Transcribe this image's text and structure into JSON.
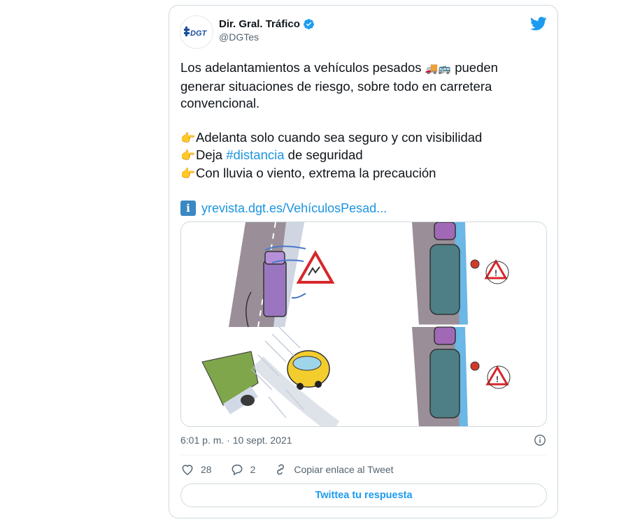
{
  "author": {
    "display_name": "Dir. Gral. Tráfico",
    "handle": "@DGTes",
    "avatar_text": "DGT",
    "verified": true
  },
  "tweet": {
    "line1": "Los adelantamientos a vehículos pesados",
    "line1_end": "pueden",
    "line2": "generar situaciones de riesgo, sobre todo en carretera",
    "line3": "convencional.",
    "bullet1": "Adelanta solo cuando sea seguro y con visibilidad",
    "bullet2_pre": "Deja",
    "bullet2_hashtag": "#distancia",
    "bullet2_post": "de seguridad",
    "bullet3": "Con lluvia o viento, extrema la precaución",
    "link_text": "yrevista.dgt.es/VehículosPesad..."
  },
  "icons": {
    "hand": "backhand-index-pointing-right-icon",
    "vehicles": [
      "truck-icon",
      "bus-icon"
    ],
    "info": "information-icon",
    "bird": "twitter-bird-icon"
  },
  "meta": {
    "time": "6:01 p. m. · 10 sept. 2021"
  },
  "actions": {
    "likes": "28",
    "replies": "2",
    "copy_link_label": "Copiar enlace al Tweet"
  },
  "reply_button_label": "Twittea tu respuesta",
  "colors": {
    "accent": "#1d9bf0",
    "link": "#1b95e0",
    "verified": "#1d9bf0",
    "text": "#0f1419",
    "secondary": "#536471"
  }
}
